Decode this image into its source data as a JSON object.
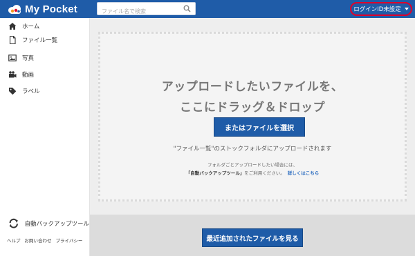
{
  "colors": {
    "brand": "#1f5ca8",
    "highlight": "#e0002a"
  },
  "header": {
    "logo_text": "My Pocket",
    "search": {
      "placeholder": "ファイル名で検索",
      "icon": "search-icon"
    },
    "login_label": "ログインID未設定"
  },
  "sidebar": {
    "items": [
      {
        "label": "ホーム",
        "icon": "home-icon"
      },
      {
        "label": "ファイル一覧",
        "icon": "file-icon"
      },
      {
        "label": "写真",
        "icon": "photo-icon"
      },
      {
        "label": "動画",
        "icon": "video-icon"
      },
      {
        "label": "ラベル",
        "icon": "tag-icon"
      }
    ],
    "backup_tool": {
      "label": "自動バックアップツール",
      "icon": "sync-icon"
    },
    "footer_links": [
      "ヘルプ",
      "お問い合わせ",
      "プライバシー"
    ]
  },
  "main": {
    "drop_title_line1": "アップロードしたいファイルを、",
    "drop_title_line2": "ここにドラッグ＆ドロップ",
    "select_button": "またはファイルを選択",
    "upload_hint": "\"ファイル一覧\"のストックフォルダにアップロードされます",
    "folder_hint_line1": "フォルダごとアップロードしたい場合には、",
    "folder_hint_tool": "「自動バックアップツール」",
    "folder_hint_tail": "をご利用ください。",
    "folder_hint_link": "詳しくはこちら",
    "recent_button": "最近追加されたファイルを見る"
  }
}
